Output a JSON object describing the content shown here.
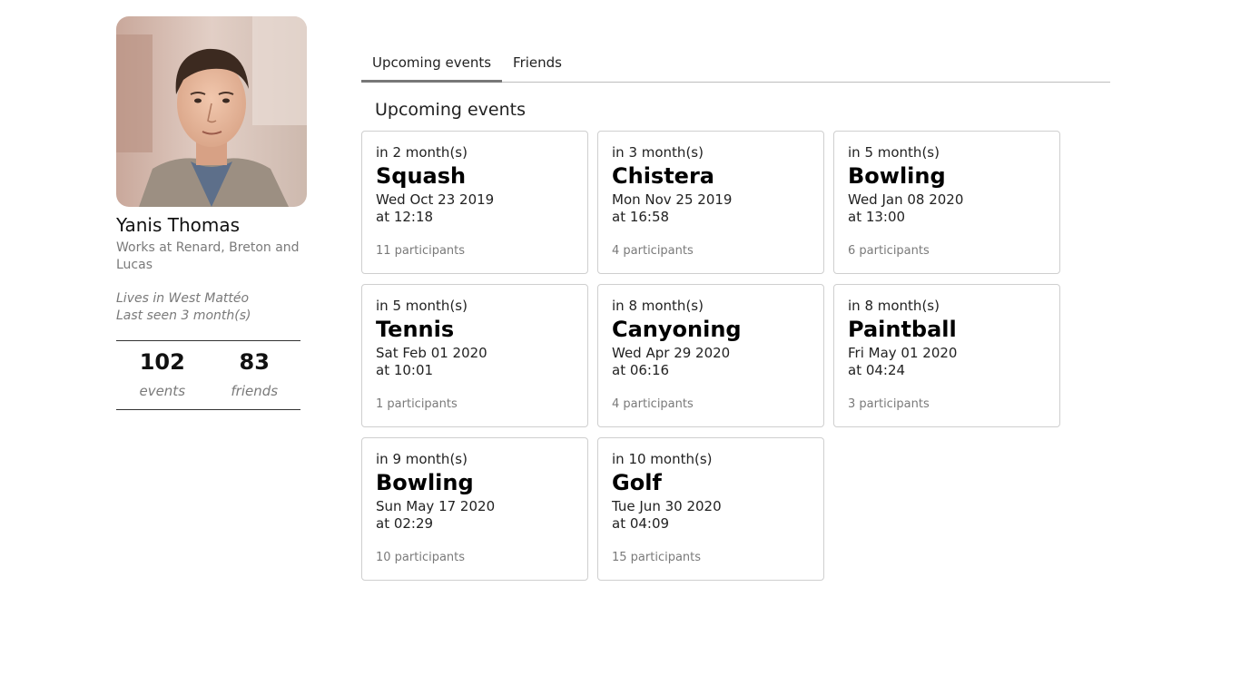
{
  "profile": {
    "name": "Yanis Thomas",
    "work": "Works at Renard, Breton and Lucas",
    "lives": "Lives in West Mattéo",
    "last_seen": "Last seen 3 month(s)",
    "events_count": "102",
    "events_label": "events",
    "friends_count": "83",
    "friends_label": "friends"
  },
  "tabs": [
    {
      "label": "Upcoming events",
      "active": true
    },
    {
      "label": "Friends",
      "active": false
    }
  ],
  "section_title": "Upcoming events",
  "events": [
    {
      "when": "in 2 month(s)",
      "title": "Squash",
      "date": "Wed Oct 23 2019",
      "time": "at 12:18",
      "participants": "11 participants"
    },
    {
      "when": "in 3 month(s)",
      "title": "Chistera",
      "date": "Mon Nov 25 2019",
      "time": "at 16:58",
      "participants": "4 participants"
    },
    {
      "when": "in 5 month(s)",
      "title": "Bowling",
      "date": "Wed Jan 08 2020",
      "time": "at 13:00",
      "participants": "6 participants"
    },
    {
      "when": "in 5 month(s)",
      "title": "Tennis",
      "date": "Sat Feb 01 2020",
      "time": "at 10:01",
      "participants": "1 participants"
    },
    {
      "when": "in 8 month(s)",
      "title": "Canyoning",
      "date": "Wed Apr 29 2020",
      "time": "at 06:16",
      "participants": "4 participants"
    },
    {
      "when": "in 8 month(s)",
      "title": "Paintball",
      "date": "Fri May 01 2020",
      "time": "at 04:24",
      "participants": "3 participants"
    },
    {
      "when": "in 9 month(s)",
      "title": "Bowling",
      "date": "Sun May 17 2020",
      "time": "at 02:29",
      "participants": "10 participants"
    },
    {
      "when": "in 10 month(s)",
      "title": "Golf",
      "date": "Tue Jun 30 2020",
      "time": "at 04:09",
      "participants": "15 participants"
    }
  ]
}
